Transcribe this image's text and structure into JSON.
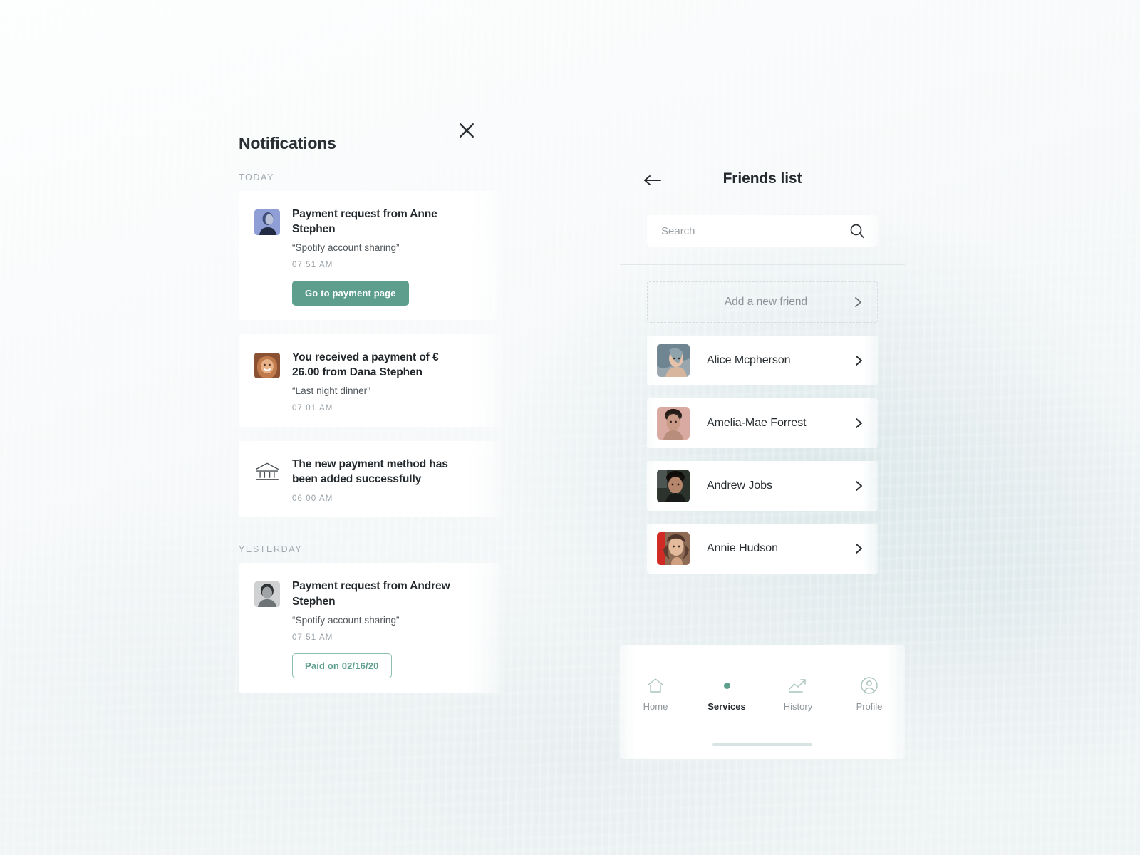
{
  "theme": {
    "accent": "#5d9e8d",
    "text_dark": "#23282c",
    "text_muted": "#9aa2a8",
    "card_bg": "#ffffff",
    "page_bg": "#f1f5f6"
  },
  "notifications": {
    "title": "Notifications",
    "close_icon": "close-icon",
    "sections": [
      {
        "label": "TODAY",
        "items": [
          {
            "avatar": "anne-stephen-avatar",
            "title": "Payment request from Anne Stephen",
            "note": "“Spotify account sharing”",
            "time": "07:51 AM",
            "action_label": "Go to payment page",
            "action_style": "primary"
          },
          {
            "avatar": "dana-stephen-avatar",
            "title": "You received a payment of € 26.00 from Dana Stephen",
            "note": "“Last night dinner”",
            "time": "07:01 AM",
            "action_label": "",
            "action_style": "none"
          },
          {
            "avatar": "bank-icon",
            "title": "The new payment method has been added successfully",
            "note": "",
            "time": "06:00 AM",
            "action_label": "",
            "action_style": "none"
          }
        ]
      },
      {
        "label": "YESTERDAY",
        "items": [
          {
            "avatar": "andrew-stephen-avatar",
            "title": "Payment request from Andrew Stephen",
            "note": "“Spotify account sharing”",
            "time": "07:51 AM",
            "action_label": "Paid on 02/16/20",
            "action_style": "outline"
          }
        ]
      }
    ]
  },
  "friends": {
    "back_icon": "arrow-left-icon",
    "title": "Friends list",
    "search": {
      "placeholder": "Search",
      "value": "",
      "icon": "search-icon"
    },
    "add_friend": {
      "label": "Add a new friend",
      "chevron": "chevron-right-icon"
    },
    "list": [
      {
        "name": "Alice Mcpherson",
        "avatar": "alice-mcpherson-avatar",
        "chevron": "chevron-right-icon"
      },
      {
        "name": "Amelia-Mae Forrest",
        "avatar": "amelia-mae-forrest-avatar",
        "chevron": "chevron-right-icon"
      },
      {
        "name": "Andrew Jobs",
        "avatar": "andrew-jobs-avatar",
        "chevron": "chevron-right-icon"
      },
      {
        "name": "Annie Hudson",
        "avatar": "annie-hudson-avatar",
        "chevron": "chevron-right-icon"
      }
    ]
  },
  "bottom_nav": {
    "items": [
      {
        "label": "Home",
        "icon": "home-icon",
        "active": false
      },
      {
        "label": "Services",
        "icon": "dot-icon",
        "active": true
      },
      {
        "label": "History",
        "icon": "trend-up-icon",
        "active": false
      },
      {
        "label": "Profile",
        "icon": "user-circle-icon",
        "active": false
      }
    ]
  }
}
